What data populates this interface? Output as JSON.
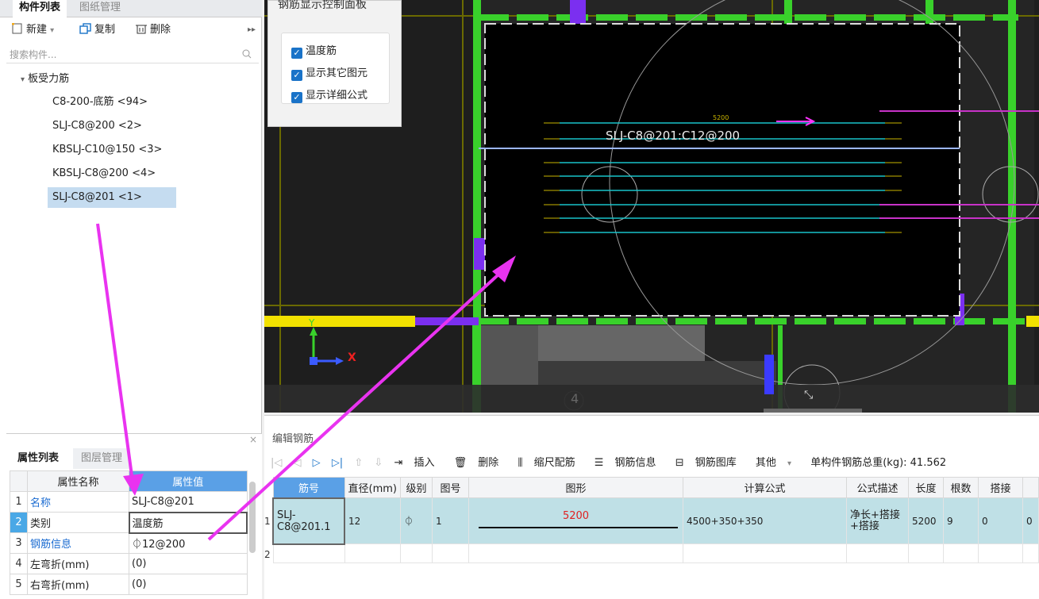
{
  "left_tabs": {
    "active": "构件列表",
    "inactive": "图纸管理"
  },
  "toolbar": {
    "new": "新建",
    "copy": "复制",
    "delete": "删除"
  },
  "search": {
    "placeholder": "搜索构件..."
  },
  "tree": {
    "root": "板受力筋",
    "items": [
      "C8-200-底筋 <94>",
      "SLJ-C8@200 <2>",
      "KBSLJ-C10@150 <3>",
      "KBSLJ-C8@200 <4>",
      "SLJ-C8@201 <1>"
    ]
  },
  "prop_tabs": {
    "active": "属性列表",
    "inactive": "图层管理"
  },
  "prop_header": {
    "name": "属性名称",
    "value": "属性值"
  },
  "props": [
    {
      "n": "1",
      "name": "名称",
      "value": "SLJ-C8@201"
    },
    {
      "n": "2",
      "name": "类别",
      "value": "温度筋"
    },
    {
      "n": "3",
      "name": "钢筋信息",
      "value": "⏀12@200"
    },
    {
      "n": "4",
      "name": "左弯折(mm)",
      "value": "(0)"
    },
    {
      "n": "5",
      "name": "右弯折(mm)",
      "value": "(0)"
    }
  ],
  "control_panel": {
    "title": "钢筋显示控制面板",
    "options": [
      "温度筋",
      "显示其它图元",
      "显示详细公式"
    ]
  },
  "canvas": {
    "rebar_label": "SLJ-C8@201:C12@200",
    "dim_label": "5200",
    "axis_x": "X",
    "axis_y": "Y",
    "grid_num": "4"
  },
  "edit_panel": {
    "title": "编辑钢筋",
    "toolbar": {
      "insert": "插入",
      "delete": "删除",
      "scale": "缩尺配筋",
      "info": "钢筋信息",
      "library": "钢筋图库",
      "other": "其他",
      "total": "单构件钢筋总重(kg): 41.562"
    },
    "headers": [
      "筋号",
      "直径(mm)",
      "级别",
      "图号",
      "图形",
      "计算公式",
      "公式描述",
      "长度",
      "根数",
      "搭接"
    ],
    "rows": [
      {
        "n": "1",
        "bar": "SLJ-C8@201.1",
        "dia": "12",
        "grade": "⏀",
        "fig": "1",
        "shape_len": "5200",
        "formula": "4500+350+350",
        "desc": "净长+搭接+搭接",
        "len": "5200",
        "count": "9",
        "lap": "0",
        "extra": "0"
      }
    ],
    "empty_row": "2"
  },
  "colors": {
    "accent": "#5aa0e6",
    "arrow": "#e933f0",
    "green": "#39d12b",
    "yellow": "#f2e100",
    "selected": "#c5dcf0"
  }
}
